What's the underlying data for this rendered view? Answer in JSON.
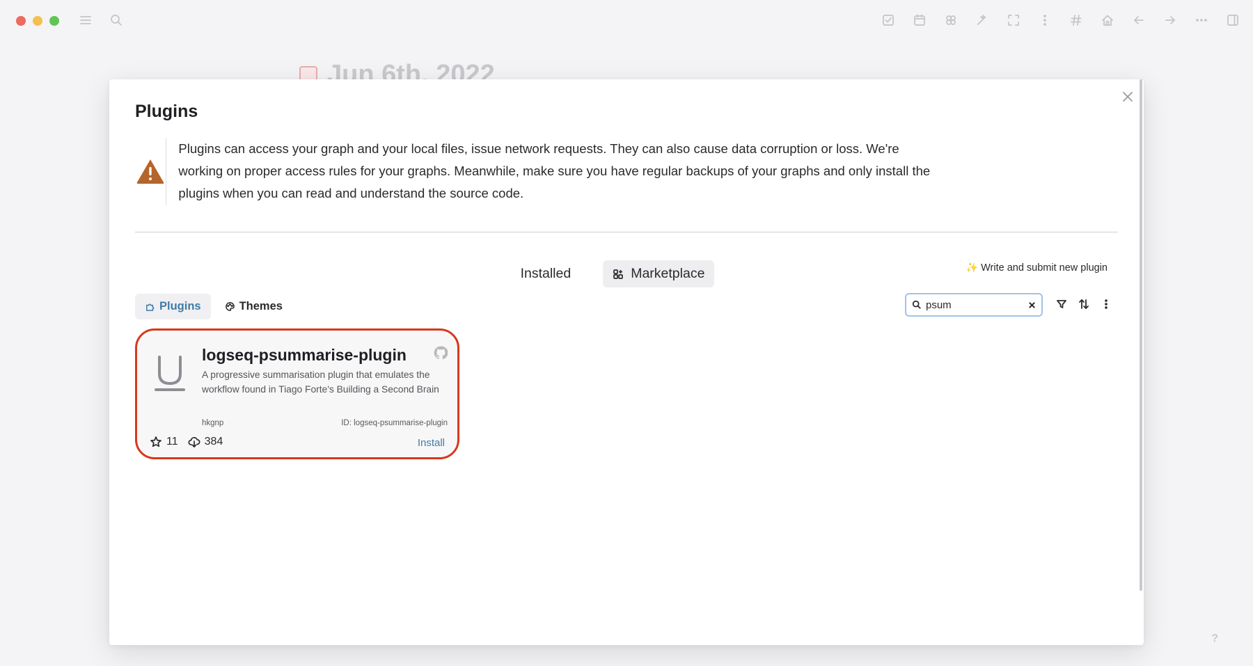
{
  "window": {
    "background_page_title": "Jun 6th, 2022"
  },
  "modal": {
    "title": "Plugins",
    "warning_text": "Plugins can access your graph and your local files, issue network requests. They can also cause data corruption or loss. We're working on proper access rules for your graphs. Meanwhile, make sure you have regular backups of your graphs and only install the plugins when you can read and understand the source code.",
    "main_tabs": [
      {
        "label": "Installed",
        "active": false
      },
      {
        "label": "Marketplace",
        "active": true
      }
    ],
    "submit_link": "Write and submit new plugin",
    "sub_tabs": [
      {
        "label": "Plugins",
        "active": true
      },
      {
        "label": "Themes",
        "active": false
      }
    ],
    "search": {
      "value": "psum",
      "placeholder": ""
    }
  },
  "plugins": [
    {
      "name": "logseq-psummarise-plugin",
      "description": "A progressive summarisation plugin that emulates the workflow found in Tiago Forte's Building a Second Brain",
      "author": "hkgnp",
      "id_label": "ID: logseq-psummarise-plugin",
      "stars": "11",
      "downloads": "384",
      "action": "Install"
    }
  ],
  "help": "?",
  "colors": {
    "accent": "#3f7ca8",
    "highlight_border": "#d8381b",
    "warning": "#b5652b"
  }
}
